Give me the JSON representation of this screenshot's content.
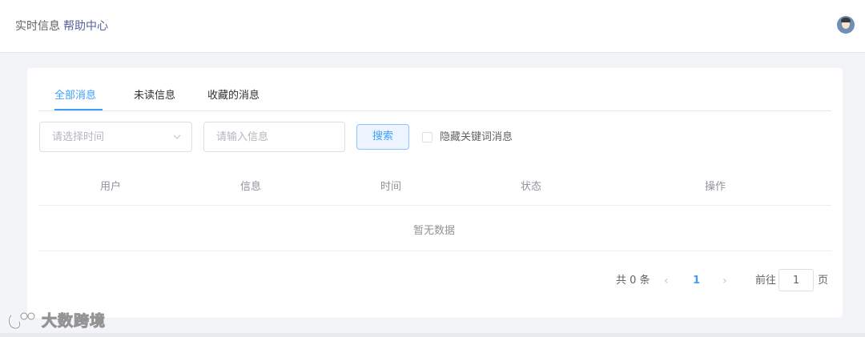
{
  "header": {
    "breadcrumb_current": "实时信息",
    "breadcrumb_link": "帮助中心"
  },
  "tabs": [
    {
      "label": "全部消息",
      "active": true
    },
    {
      "label": "未读信息",
      "active": false
    },
    {
      "label": "收藏的消息",
      "active": false
    }
  ],
  "filters": {
    "time_select_placeholder": "请选择时间",
    "info_input_placeholder": "请输入信息",
    "info_input_value": "",
    "search_label": "搜索",
    "hide_keyword_label": "隐藏关键词消息",
    "hide_keyword_checked": false
  },
  "table": {
    "columns": [
      "用户",
      "信息",
      "时间",
      "状态",
      "操作"
    ],
    "rows": [],
    "empty_text": "暂无数据"
  },
  "pagination": {
    "total_text": "共 0 条",
    "prev_icon": "‹",
    "current_page": "1",
    "next_icon": "›",
    "goto_label": "前往",
    "goto_value": "1",
    "page_suffix": "页"
  },
  "watermark": {
    "text": "大数跨境"
  },
  "icons": {
    "select": "chevron-down-icon",
    "avatar": "user-avatar-icon",
    "watermark": "logo-icon"
  },
  "colors": {
    "primary": "#409eff",
    "breadcrumb_link": "#5a5e9e",
    "background": "#f3f4f7"
  }
}
